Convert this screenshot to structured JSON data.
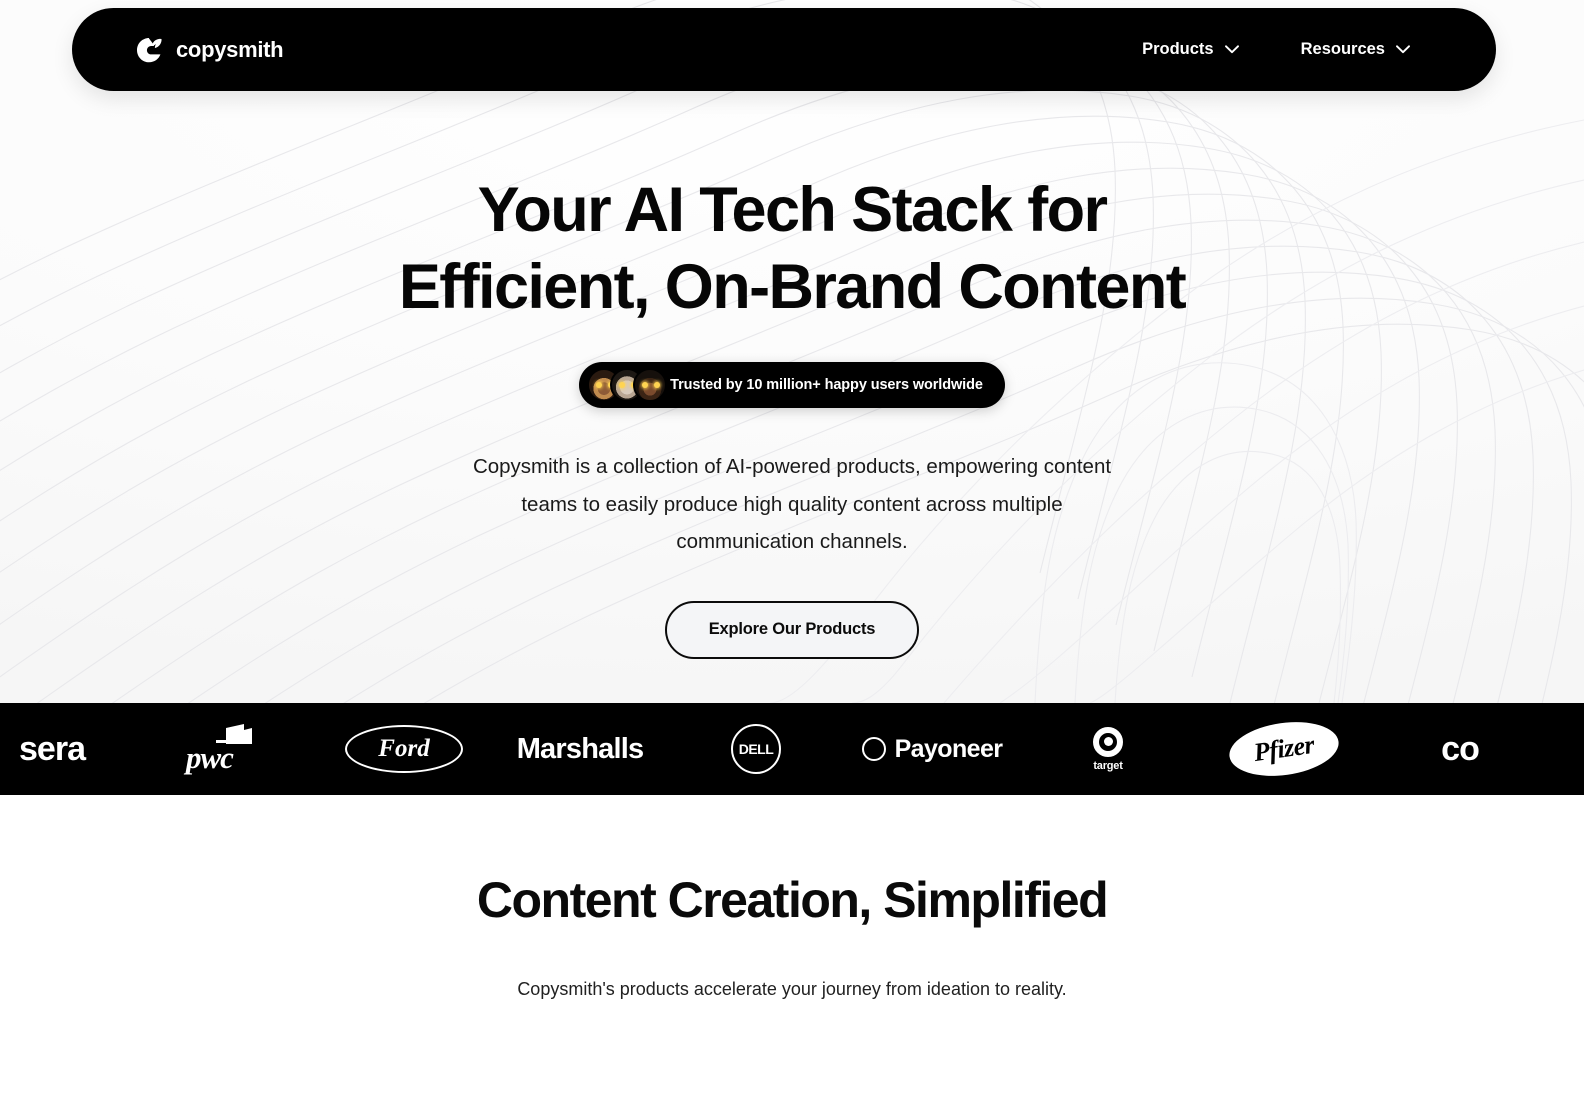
{
  "navbar": {
    "brand_name": "copysmith",
    "brand_icon": "copysmith-leaf-logo-icon",
    "links": [
      {
        "label": "Products",
        "icon": "chevron-down-icon"
      },
      {
        "label": "Resources",
        "icon": "chevron-down-icon"
      }
    ]
  },
  "hero": {
    "headline_line1": "Your AI Tech Stack for",
    "headline_line2": "Efficient, On-Brand Content",
    "badge_text": "Trusted by 10 million+ happy users worldwide",
    "avatar_count": 3,
    "subtext": "Copysmith is a collection of AI-powered products, empowering content teams to easily produce high quality content across multiple communication channels.",
    "cta_label": "Explore Our Products",
    "background_pattern": "topographic-contour-lines"
  },
  "logo_marquee": {
    "logos": [
      {
        "name": "coursera",
        "text": "sera"
      },
      {
        "name": "pwc",
        "text": "pwc"
      },
      {
        "name": "ford",
        "text": "Ford"
      },
      {
        "name": "marshalls",
        "text": "Marshalls"
      },
      {
        "name": "dell",
        "text": "DELL"
      },
      {
        "name": "payoneer",
        "text": "Payoneer"
      },
      {
        "name": "target",
        "text": "target"
      },
      {
        "name": "pfizer",
        "text": "Pfizer"
      },
      {
        "name": "coursera-repeat",
        "text": "co"
      }
    ]
  },
  "section2": {
    "title": "Content Creation, Simplified",
    "subtitle": "Copysmith's products accelerate your journey from ideation to reality."
  },
  "colors": {
    "ink": "#000000",
    "page_bg": "#ffffff",
    "cta_bg": "#f4f5f7",
    "contour_line": "#e9e9ec"
  }
}
